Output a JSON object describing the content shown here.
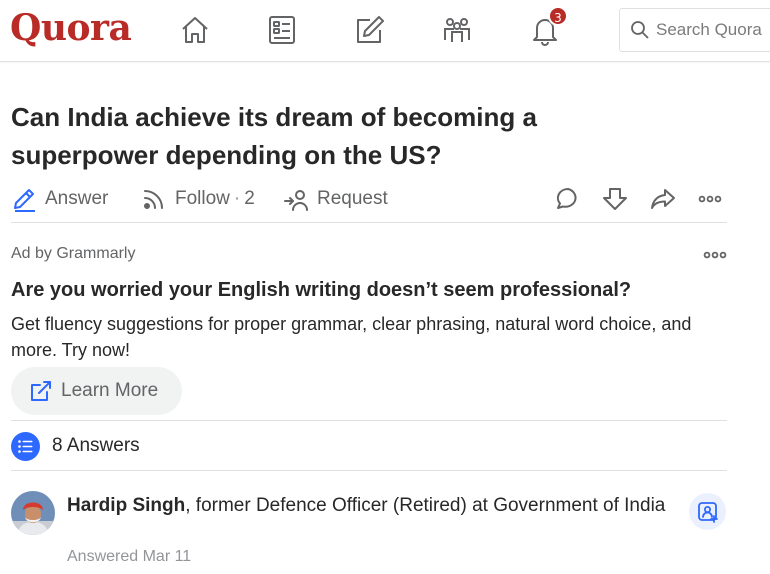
{
  "header": {
    "logo": "Quora",
    "notification_count": "3",
    "search_placeholder": "Search Quora",
    "brand_color": "#b92b27",
    "nav_icons": [
      "home-icon",
      "following-icon",
      "write-icon",
      "spaces-icon",
      "bell-icon"
    ]
  },
  "question": {
    "title": "Can India achieve its dream of becoming a superpower depending on the US?",
    "answer_label": "Answer",
    "follow_label": "Follow",
    "follow_sep": "·",
    "follow_count": "2",
    "request_label": "Request",
    "action_icons": [
      "comment-icon",
      "downvote-icon",
      "share-icon",
      "more-icon"
    ]
  },
  "ad": {
    "label": "Ad by Grammarly",
    "title": "Are you worried your English writing doesn’t seem professional?",
    "body": "Get fluency suggestions for proper grammar, clear phrasing, natural word choice, and more. Try now!",
    "cta": "Learn More"
  },
  "answers": {
    "count_label": "8 Answers",
    "accent_color": "#2e69ff"
  },
  "answer": {
    "author_name": "Hardip Singh",
    "author_credential": ", former Defence Officer (Retired) at Government of India",
    "answered": "Answered Mar 11"
  }
}
